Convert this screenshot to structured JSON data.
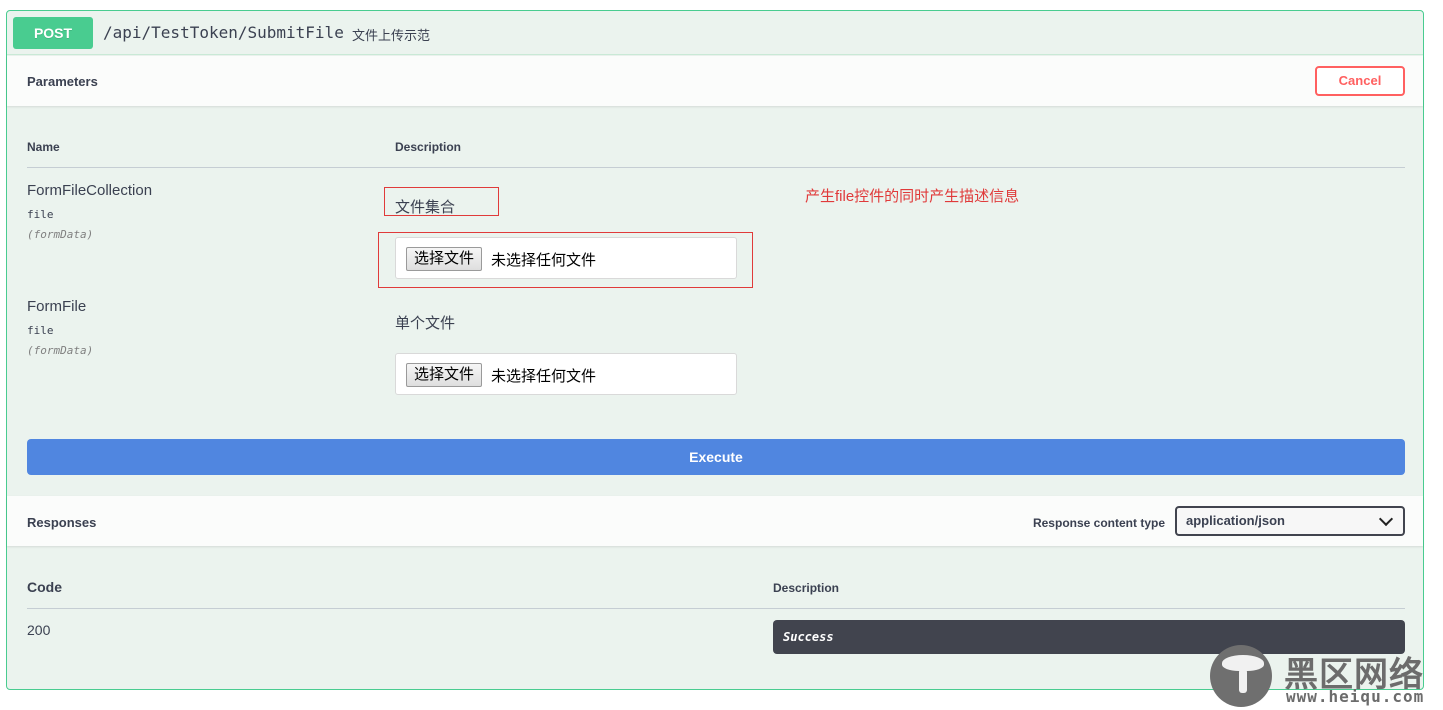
{
  "summary": {
    "method": "POST",
    "path": "/api/TestToken/SubmitFile",
    "description": "文件上传示范"
  },
  "parameters": {
    "title": "Parameters",
    "cancel_label": "Cancel",
    "col_name": "Name",
    "col_description": "Description",
    "items": [
      {
        "name": "FormFileCollection",
        "type": "file",
        "in": "(formData)",
        "description": "文件集合",
        "file_button": "选择文件",
        "file_status": "未选择任何文件"
      },
      {
        "name": "FormFile",
        "type": "file",
        "in": "(formData)",
        "description": "单个文件",
        "file_button": "选择文件",
        "file_status": "未选择任何文件"
      }
    ],
    "annotation": "产生file控件的同时产生描述信息"
  },
  "execute_label": "Execute",
  "responses": {
    "title": "Responses",
    "content_type_label": "Response content type",
    "content_type_value": "application/json",
    "col_code": "Code",
    "col_description": "Description",
    "rows": [
      {
        "code": "200",
        "description": "Success"
      }
    ]
  },
  "watermark": {
    "text": "黑区网络",
    "url": "www.heiqu.com"
  },
  "colors": {
    "post": "#49cc90",
    "execute": "#5086e0",
    "cancel": "#ff6060",
    "annotation": "#e03a3a",
    "success_bg": "#41444e"
  }
}
